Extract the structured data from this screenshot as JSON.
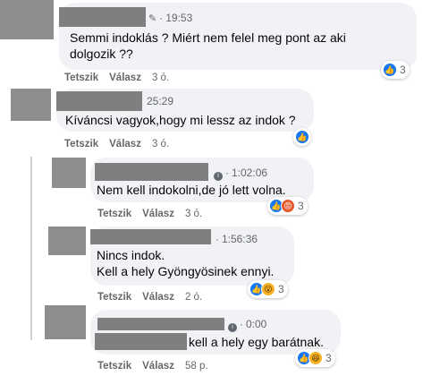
{
  "comments": [
    {
      "time": "19:53",
      "line1": "Semmi indoklás ? Miért nem felel meg pont az aki",
      "line2": "dolgozik ??",
      "like_label": "Tetszik",
      "reply_label": "Válasz",
      "age": "3 ó.",
      "reaction_count": "3",
      "reactions": [
        "like-icon"
      ]
    },
    {
      "time": "25:29",
      "line1": "Kíváncsi vagyok,hogy mi lessz az indok ?",
      "like_label": "Tetszik",
      "reply_label": "Válasz",
      "age": "3 ó.",
      "reactions": [
        "like-icon"
      ]
    },
    {
      "time": "1:02:06",
      "line1": "Nem kell indokolni,de jó lett volna.",
      "like_label": "Tetszik",
      "reply_label": "Válasz",
      "age": "3 ó.",
      "reaction_count": "3",
      "reactions": [
        "like-icon",
        "angry-icon"
      ]
    },
    {
      "time": "1:56:36",
      "line1": "Nincs indok.",
      "line2": "Kell a hely Gyöngyösinek ennyi.",
      "like_label": "Tetszik",
      "reply_label": "Válasz",
      "age": "2 ó.",
      "reaction_count": "3",
      "reactions": [
        "like-icon",
        "wow-icon"
      ]
    },
    {
      "time": "0:00",
      "line1": "kell a hely egy barátnak.",
      "like_label": "Tetszik",
      "reply_label": "Válasz",
      "age": "58 p.",
      "reaction_count": "3",
      "reactions": [
        "like-icon",
        "haha-icon"
      ]
    }
  ],
  "colors": {
    "like": "#1877f2",
    "bubble": "#f0f2f5",
    "meta": "#65676b"
  }
}
